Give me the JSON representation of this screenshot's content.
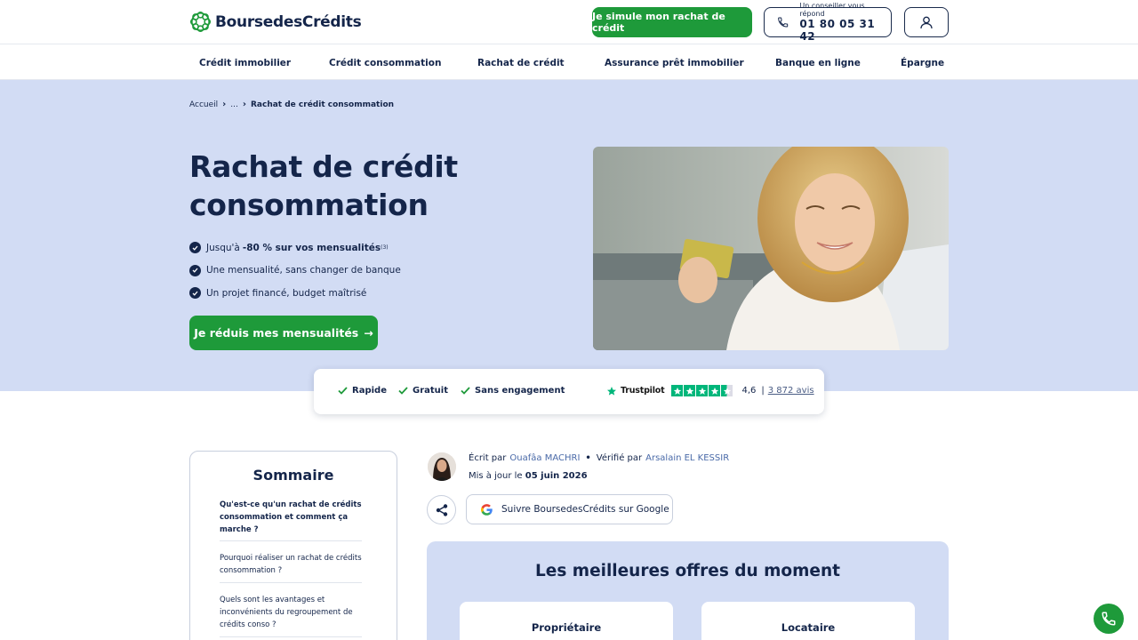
{
  "header": {
    "logo_text": "BoursedesCrédits",
    "simulate_label": "Je simule mon rachat de crédit",
    "advisor_caption": "Un conseiller vous répond",
    "phone_number": "01 80 05 31 42"
  },
  "nav": {
    "items": [
      {
        "label": "Crédit immobilier"
      },
      {
        "label": "Crédit consommation"
      },
      {
        "label": "Rachat de crédit"
      },
      {
        "label": "Assurance prêt immobilier"
      },
      {
        "label": "Banque en ligne"
      },
      {
        "label": "Épargne"
      }
    ]
  },
  "breadcrumb": {
    "home": "Accueil",
    "ellipsis": "...",
    "current": "Rachat de crédit consommation"
  },
  "hero": {
    "title": "Rachat de crédit consommation",
    "bullet1_prefix": "Jusqu'à",
    "bullet1_strong": "-80 % sur vos mensualités",
    "bullet1_note": "(3)",
    "bullet2": "Une mensualité, sans changer de banque",
    "bullet3": "Un projet financé, budget maîtrisé",
    "cta_label": "Je réduis mes mensualités",
    "cta_arrow": "→"
  },
  "trust": {
    "items": [
      "Rapide",
      "Gratuit",
      "Sans engagement"
    ],
    "trustpilot_name": "Trustpilot",
    "rating": "4,6",
    "separator": "|",
    "reviews": "3 872 avis",
    "stars": 4.5
  },
  "toc": {
    "title": "Sommaire",
    "items": [
      {
        "label": "Qu'est-ce qu'un rachat de crédits consommation et comment ça marche ?"
      },
      {
        "label": "Pourquoi réaliser un rachat de crédits consommation ?"
      },
      {
        "label": "Quels sont les avantages et inconvénients du regroupement de crédits conso ?"
      }
    ]
  },
  "author": {
    "written_by": "Écrit par",
    "author_name": "Ouafâa MACHRI",
    "dot": "•",
    "verified_by": "Vérifié par",
    "verifier_name": "Arsalain EL KESSIR",
    "updated_prefix": "Mis à jour le",
    "updated_date": "05 juin 2026",
    "google_follow": "Suivre BoursedesCrédits sur Google"
  },
  "offers": {
    "title": "Les meilleures offres du moment",
    "cards": [
      {
        "label": "Propriétaire"
      },
      {
        "label": "Locataire"
      }
    ]
  },
  "colors": {
    "brand_navy": "#14254a",
    "brand_green": "#1e9a3a",
    "hero_bg": "#d2dcf4",
    "trustpilot_green": "#00b67a"
  },
  "icons": {
    "phone": "phone-icon",
    "account": "user-icon",
    "share": "share-icon",
    "google": "google-icon",
    "call": "phone-icon"
  }
}
